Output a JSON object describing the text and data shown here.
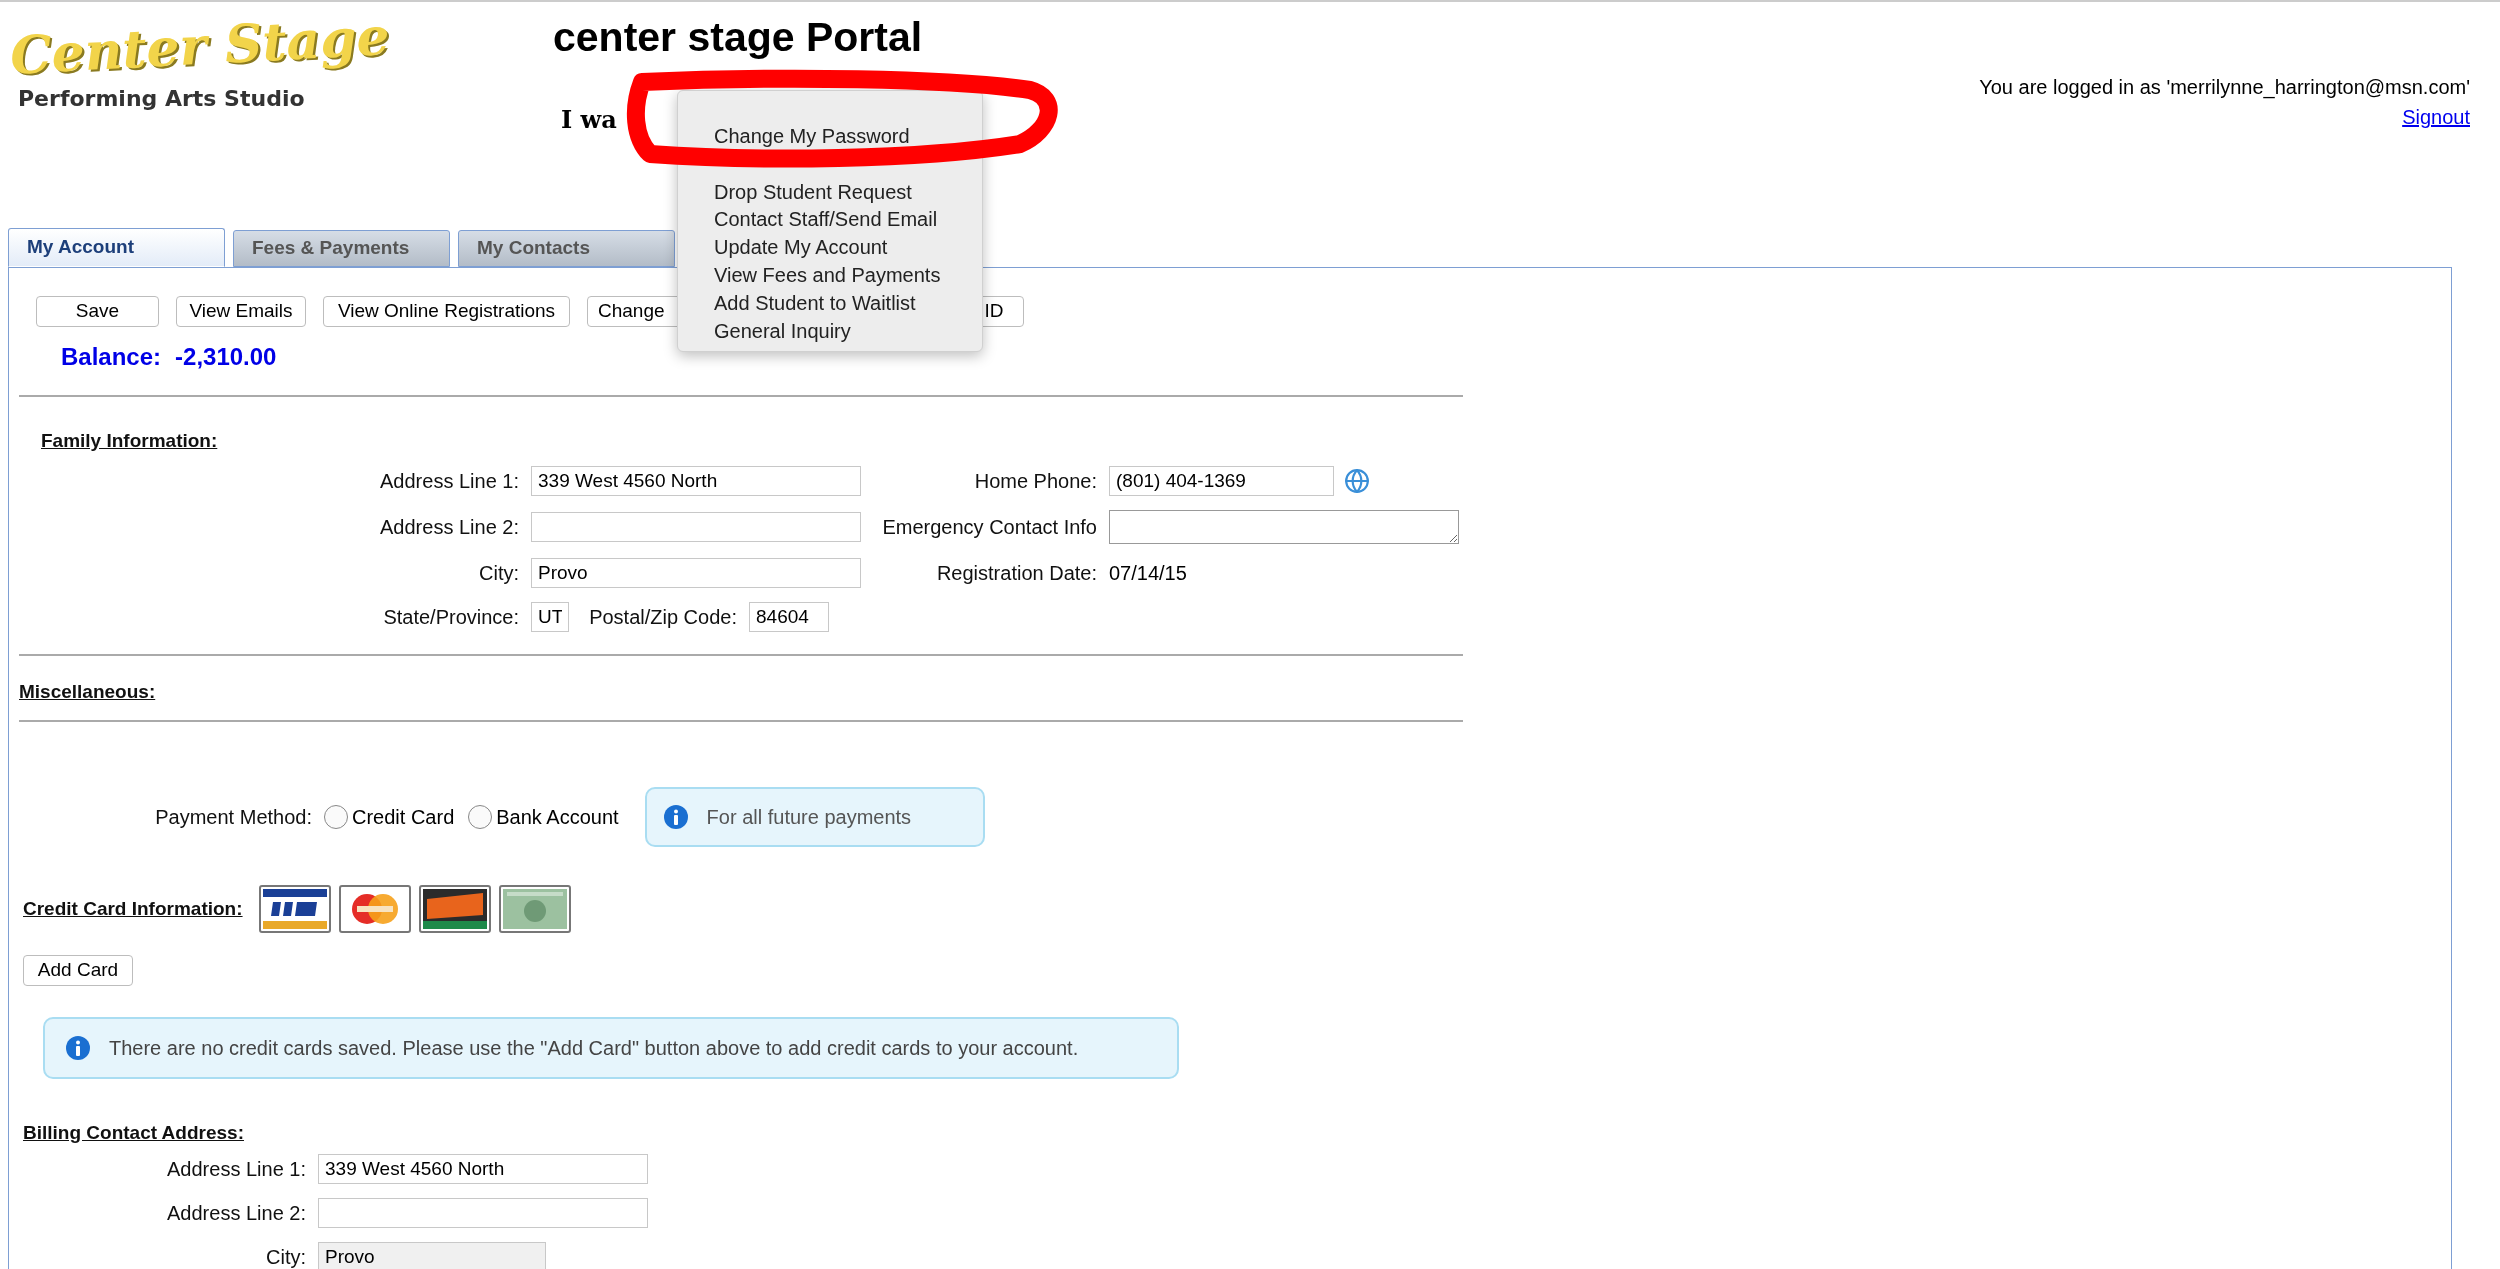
{
  "logo": {
    "name": "Center Stage",
    "tagline": "Performing Arts Studio"
  },
  "title": "center stage Portal",
  "i_want_to": "I wa",
  "account": {
    "logged_in": "You are logged in as 'merrilynne_harrington@msn.com'",
    "signout": "Signout"
  },
  "menu": {
    "items": [
      "Change My Password",
      "Drop Student Request",
      "Contact Staff/Send Email",
      "Update My Account",
      "View Fees and Payments",
      "Add Student to Waitlist",
      "General Inquiry"
    ]
  },
  "tabs": [
    {
      "label": "My Account",
      "selected": true
    },
    {
      "label": "Fees & Payments",
      "selected": false
    },
    {
      "label": "My Contacts",
      "selected": false
    }
  ],
  "toolbar": [
    "Save",
    "View Emails",
    "View Online Registrations",
    "Change",
    "ID"
  ],
  "balance": {
    "label": "Balance:",
    "value": "-2,310.00"
  },
  "family": {
    "heading": "Family Information:",
    "address1": {
      "label": "Address Line 1:",
      "value": "339 West 4560 North"
    },
    "address2": {
      "label": "Address Line 2:"
    },
    "city": {
      "label": "City:",
      "value": "Provo"
    },
    "state": {
      "label": "State/Province:",
      "value": "UT"
    },
    "zip": {
      "label": "Postal/Zip Code:",
      "value": "84604"
    },
    "home_phone": {
      "label": "Home Phone:",
      "value": "(801) 404-1369"
    },
    "emergency": {
      "label": "Emergency Contact Info"
    },
    "registration_date": {
      "label": "Registration Date:",
      "value": "07/14/15"
    }
  },
  "miscellaneous": {
    "heading": "Miscellaneous:"
  },
  "payment": {
    "label": "Payment Method:",
    "options": [
      {
        "label": "Credit Card",
        "selected": false
      },
      {
        "label": "Bank Account",
        "selected": false
      }
    ],
    "note": "For all future payments"
  },
  "credit_card": {
    "heading": "Credit Card Information:",
    "add_button": "Add Card",
    "notice": "There are no credit cards saved. Please use the \"Add Card\" button above to add credit cards to your account."
  },
  "billing": {
    "heading": "Billing Contact Address:",
    "fields": [
      {
        "label": "Address Line 1:",
        "value": "339 West 4560 North",
        "disabled": false
      },
      {
        "label": "Address Line 2:",
        "disabled": false
      },
      {
        "label": "City:",
        "value": "Provo",
        "disabled": true
      }
    ]
  }
}
